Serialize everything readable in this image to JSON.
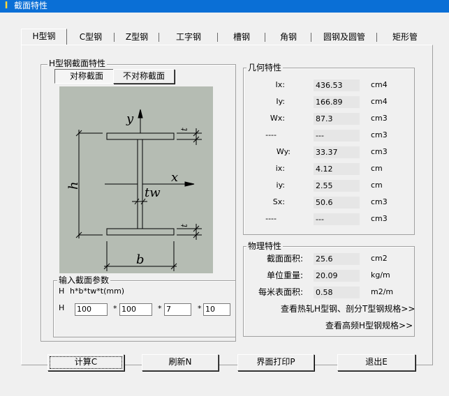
{
  "window": {
    "title": "截面特性",
    "icon": "i-beam-app-icon"
  },
  "tabs": [
    {
      "label": "H型钢",
      "active": true
    },
    {
      "label": "C型钢",
      "active": false
    },
    {
      "label": "Z型钢",
      "active": false
    },
    {
      "label": "工字钢",
      "active": false
    },
    {
      "label": "槽钢",
      "active": false
    },
    {
      "label": "角钢",
      "active": false
    },
    {
      "label": "圆钢及圆管",
      "active": false
    },
    {
      "label": "矩形管",
      "active": false
    }
  ],
  "section": {
    "group_label": "H型钢截面特性",
    "symmetric_label": "对称截面",
    "asymmetric_label": "不对称截面"
  },
  "diagram_labels": {
    "y": "y",
    "x": "x",
    "h": "h",
    "tw": "tw",
    "b": "b",
    "t_top": "t",
    "t_bottom": "t"
  },
  "inputs": {
    "group_label": "输入截面参数",
    "formula_prefix": "H",
    "formula": "h*b*tw*t(mm)",
    "row_prefix": "H",
    "sep1": "*",
    "sep2": "*",
    "sep3": "*",
    "h": "100",
    "b": "100",
    "tw": "7",
    "t": "10"
  },
  "geometry": {
    "group_label": "几何特性",
    "rows": [
      {
        "label": "Ix:",
        "value": "436.53",
        "unit": "cm4"
      },
      {
        "label": "Iy:",
        "value": "166.89",
        "unit": "cm4"
      },
      {
        "label": "Wx:",
        "value": "87.3",
        "unit": "cm3"
      },
      {
        "label": "----",
        "value": "---",
        "unit": "cm3"
      },
      {
        "label": "Wy:",
        "value": "33.37",
        "unit": "cm3"
      },
      {
        "label": "ix:",
        "value": "4.12",
        "unit": "cm"
      },
      {
        "label": "iy:",
        "value": "2.55",
        "unit": "cm"
      },
      {
        "label": "Sx:",
        "value": "50.6",
        "unit": "cm3"
      },
      {
        "label": "----",
        "value": "---",
        "unit": "cm3"
      }
    ]
  },
  "physics": {
    "group_label": "物理特性",
    "rows": [
      {
        "label": "截面面积:",
        "value": "25.6",
        "unit": "cm2"
      },
      {
        "label": "单位重量:",
        "value": "20.09",
        "unit": "kg/m"
      },
      {
        "label": "每米表面积:",
        "value": "0.58",
        "unit": "m2/m"
      }
    ],
    "link1": "查看热轧H型钢、剖分T型钢规格>>",
    "link2": "查看高频H型钢规格>>"
  },
  "buttons": {
    "calc": "计算C",
    "refresh": "刷新N",
    "print": "界面打印P",
    "exit": "退出E"
  }
}
